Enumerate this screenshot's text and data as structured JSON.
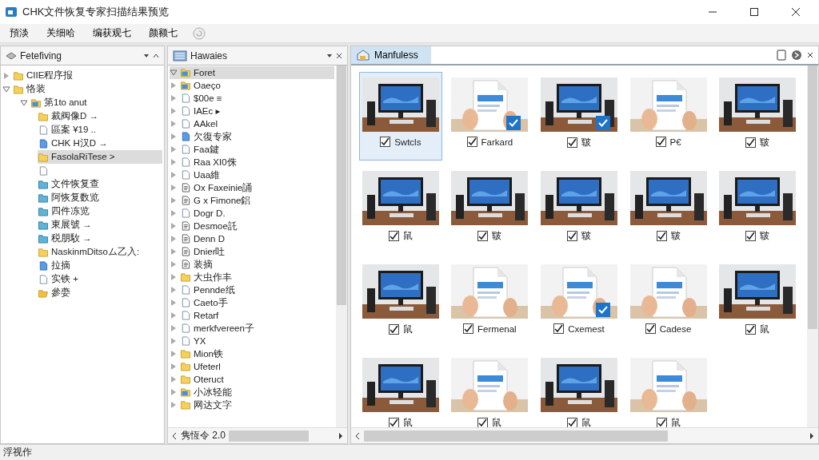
{
  "window": {
    "title": "CHK文件恢复专家扫描结果预览"
  },
  "toolbar": {
    "items": [
      {
        "label": "預淡"
      },
      {
        "label": "关细哈"
      },
      {
        "label": "编获观七"
      },
      {
        "label": "颜额七"
      }
    ]
  },
  "left_pane": {
    "title": "Fetefiving",
    "tree": [
      {
        "label": "CIIE程序报",
        "kind": "folder",
        "expanded": false,
        "selected": false
      },
      {
        "label": "恪装",
        "kind": "folder",
        "expanded": true,
        "selected": false,
        "children": [
          {
            "label": "第1to anut",
            "kind": "blue-folder",
            "expanded": true,
            "selected": false,
            "children": [
              {
                "label": "裁阀像D →",
                "kind": "folder",
                "selected": false
              },
              {
                "label": "區案 ¥19 ..",
                "kind": "file",
                "selected": false
              },
              {
                "label": "CHK H汉D →",
                "kind": "blue-file",
                "selected": false
              },
              {
                "label": "FasolaRiTese >",
                "kind": "folder",
                "selected": true
              },
              {
                "kind": "file",
                "selected": false
              },
              {
                "label": "文件恢复查",
                "kind": "teal-folder",
                "selected": false
              },
              {
                "label": "阿恢复数览",
                "kind": "teal-folder",
                "selected": false
              },
              {
                "label": "四件冻览",
                "kind": "teal-folder",
                "selected": false
              },
              {
                "label": "東展號 →",
                "kind": "teal-folder",
                "selected": false
              },
              {
                "label": "税朋駇 →",
                "kind": "teal-folder",
                "selected": false
              },
              {
                "label": "NaskinmDitsoム乙入:",
                "kind": "folder",
                "selected": false
              },
              {
                "label": "拉摘",
                "kind": "blue-file",
                "selected": false
              },
              {
                "label": "实铁 +",
                "kind": "file",
                "selected": false
              },
              {
                "label": "參嬊",
                "kind": "open-folder",
                "selected": false
              }
            ]
          }
        ]
      }
    ]
  },
  "middle_pane": {
    "title": "Hawaies",
    "items": [
      {
        "label": "Foret",
        "kind": "blue-folder",
        "expanded": true,
        "selected": true
      },
      {
        "label": "Оаеçо",
        "kind": "blue-folder",
        "expanded": false,
        "selected": false
      },
      {
        "label": "$00e ≡",
        "kind": "file",
        "expanded": false,
        "selected": false
      },
      {
        "label": "IAEc ▸",
        "kind": "file",
        "expanded": false,
        "selected": false
      },
      {
        "label": "AAkel",
        "kind": "file",
        "expanded": false,
        "selected": false
      },
      {
        "label": "欠復专家",
        "kind": "blue-file",
        "expanded": false,
        "selected": false
      },
      {
        "label": "Faa鍵",
        "kind": "file",
        "expanded": false,
        "selected": false
      },
      {
        "label": "Raa XI0侏",
        "kind": "file",
        "expanded": false,
        "selected": false
      },
      {
        "label": "Uaa維",
        "kind": "file",
        "expanded": false,
        "selected": false
      },
      {
        "label": "Ox Faxeinie誦",
        "kind": "doc",
        "expanded": false,
        "selected": false
      },
      {
        "label": "G x Fimone鋁",
        "kind": "doc",
        "expanded": false,
        "selected": false
      },
      {
        "label": "Dogr D.",
        "kind": "file",
        "expanded": false,
        "selected": false
      },
      {
        "label": "Desmoe託",
        "kind": "doc",
        "expanded": false,
        "selected": false
      },
      {
        "label": "Denn D",
        "kind": "doc",
        "expanded": false,
        "selected": false
      },
      {
        "label": "Dnier吐",
        "kind": "doc",
        "expanded": false,
        "selected": false
      },
      {
        "label": "装摘",
        "kind": "doc",
        "expanded": false,
        "selected": false
      },
      {
        "label": "大虫作丰",
        "kind": "folder",
        "expanded": false,
        "selected": false
      },
      {
        "label": "Penndе纸",
        "kind": "file",
        "expanded": false,
        "selected": false
      },
      {
        "label": "Caeto手",
        "kind": "file",
        "expanded": false,
        "selected": false
      },
      {
        "label": "Retarf",
        "kind": "file",
        "expanded": false,
        "selected": false
      },
      {
        "label": "merkfvereen子",
        "kind": "file",
        "expanded": false,
        "selected": false
      },
      {
        "label": "YX",
        "kind": "file",
        "expanded": false,
        "selected": false
      },
      {
        "label": "Mion铁",
        "kind": "folder",
        "expanded": false,
        "selected": false
      },
      {
        "label": "Ufeterl",
        "kind": "folder",
        "expanded": false,
        "selected": false
      },
      {
        "label": "Oteruct",
        "kind": "folder",
        "expanded": false,
        "selected": false
      },
      {
        "label": "小冰轻能",
        "kind": "blue-folder",
        "expanded": false,
        "selected": false
      },
      {
        "label": "网达文字",
        "kind": "folder",
        "expanded": false,
        "selected": false
      }
    ],
    "scroll_label": "隽恆令 2.0"
  },
  "right_pane": {
    "tab": "Manfuless",
    "items": [
      {
        "label": "Swtcls",
        "checked": true,
        "marked": false,
        "selected": true
      },
      {
        "label": "Farkard",
        "checked": true,
        "marked": true,
        "selected": false
      },
      {
        "label": "皲",
        "checked": true,
        "marked": true,
        "selected": false
      },
      {
        "label": "Р€",
        "checked": true,
        "marked": false,
        "selected": false
      },
      {
        "label": "皲",
        "checked": true,
        "marked": false,
        "selected": false
      },
      {
        "label": "鼠",
        "checked": true,
        "marked": false,
        "selected": false
      },
      {
        "label": "皲",
        "checked": true,
        "marked": false,
        "selected": false
      },
      {
        "label": "皲",
        "checked": true,
        "marked": false,
        "selected": false
      },
      {
        "label": "皲",
        "checked": true,
        "marked": false,
        "selected": false
      },
      {
        "label": "皲",
        "checked": true,
        "marked": false,
        "selected": false
      },
      {
        "label": "鼠",
        "checked": true,
        "marked": false,
        "selected": false
      },
      {
        "label": "Fermenal",
        "checked": true,
        "marked": false,
        "selected": false
      },
      {
        "label": "Cxemest",
        "checked": true,
        "marked": true,
        "selected": false
      },
      {
        "label": "Cadese",
        "checked": true,
        "marked": false,
        "selected": false
      },
      {
        "label": "鼠",
        "checked": true,
        "marked": false,
        "selected": false
      },
      {
        "label": "鼠",
        "checked": true,
        "marked": false,
        "selected": false
      },
      {
        "label": "鼠",
        "checked": true,
        "marked": false,
        "selected": false
      },
      {
        "label": "鼠",
        "checked": true,
        "marked": false,
        "selected": false
      },
      {
        "label": "鼠",
        "checked": true,
        "marked": false,
        "selected": false
      }
    ]
  },
  "status_bar": {
    "text": "浮视作"
  }
}
